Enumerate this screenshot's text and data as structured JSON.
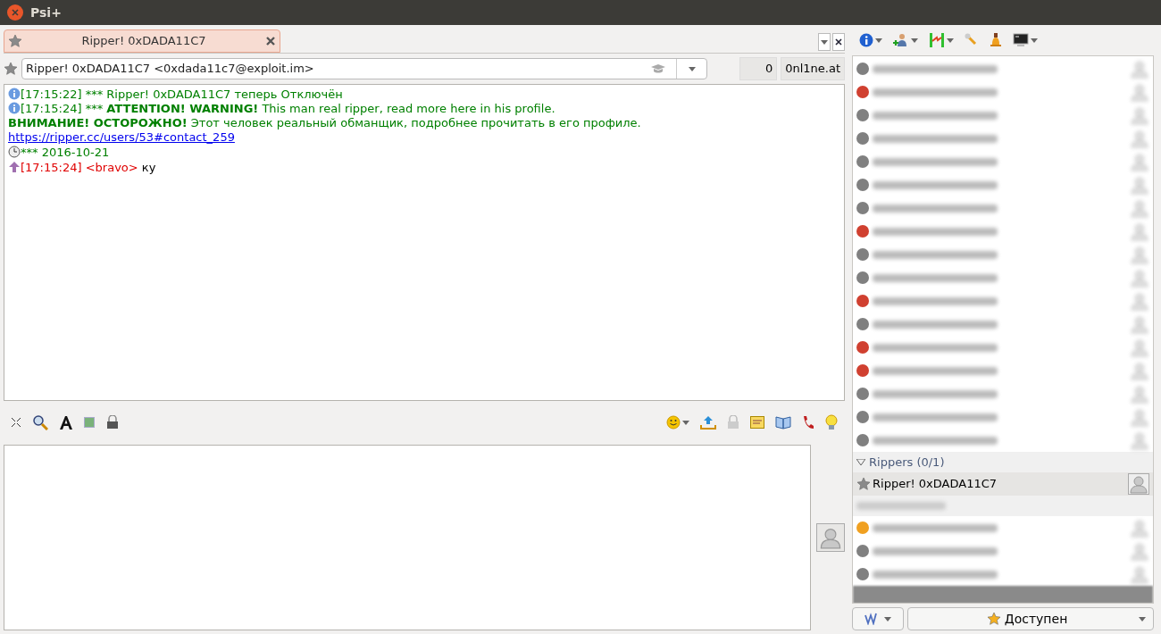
{
  "window": {
    "title": "Psi+"
  },
  "tabs": [
    {
      "label": "Ripper! 0xDADA11C7",
      "selected": true
    }
  ],
  "address": {
    "value": "Ripper! 0xDADA11C7 <0xdada11c7@exploit.im>",
    "counter": "0",
    "account": "0nl1ne.at"
  },
  "messages": [
    {
      "kind": "info",
      "time": "[17:15:22]",
      "text": "*** Ripper! 0xDADA11C7 теперь Отключён"
    },
    {
      "kind": "info",
      "time": "[17:15:24]",
      "prefix": "***",
      "text": "**ATTENTION! WARNING!** This man real ripper, read more here in his profile.",
      "extra_lines": [
        "**ВНИМАНИЕ! ОСТОРОЖНО!** Этот человек реальный обманщик, подробнее прочитать в его профиле."
      ],
      "link": "https://ripper.cc/users/53#contact_259"
    },
    {
      "kind": "date",
      "text": "*** 2016-10-21"
    },
    {
      "kind": "chat",
      "time": "[17:15:24]",
      "nick": "<bravo>",
      "text": "ку"
    }
  ],
  "roster": [
    {
      "kind": "blurred",
      "color": "#808080"
    },
    {
      "kind": "blurred",
      "color": "#d04030"
    },
    {
      "kind": "blurred",
      "color": "#808080"
    },
    {
      "kind": "blurred",
      "color": "#808080"
    },
    {
      "kind": "blurred",
      "color": "#808080"
    },
    {
      "kind": "blurred",
      "color": "#808080"
    },
    {
      "kind": "blurred",
      "color": "#808080"
    },
    {
      "kind": "blurred",
      "color": "#d04030"
    },
    {
      "kind": "blurred",
      "color": "#808080"
    },
    {
      "kind": "blurred",
      "color": "#808080"
    },
    {
      "kind": "blurred",
      "color": "#d04030"
    },
    {
      "kind": "blurred",
      "color": "#808080"
    },
    {
      "kind": "blurred",
      "color": "#d04030"
    },
    {
      "kind": "blurred",
      "color": "#d04030"
    },
    {
      "kind": "blurred",
      "color": "#808080"
    },
    {
      "kind": "blurred",
      "color": "#808080"
    },
    {
      "kind": "blurred",
      "color": "#808080"
    },
    {
      "kind": "group",
      "label": "Rippers (0/1)",
      "expanded": true
    },
    {
      "kind": "contact",
      "label": "Ripper! 0xDADA11C7",
      "selected": true
    },
    {
      "kind": "blurred-group"
    },
    {
      "kind": "blurred",
      "color": "#f0a020"
    },
    {
      "kind": "blurred",
      "color": "#808080"
    },
    {
      "kind": "blurred",
      "color": "#808080"
    },
    {
      "kind": "blurred-bar"
    }
  ],
  "status": {
    "label": "Доступен"
  }
}
